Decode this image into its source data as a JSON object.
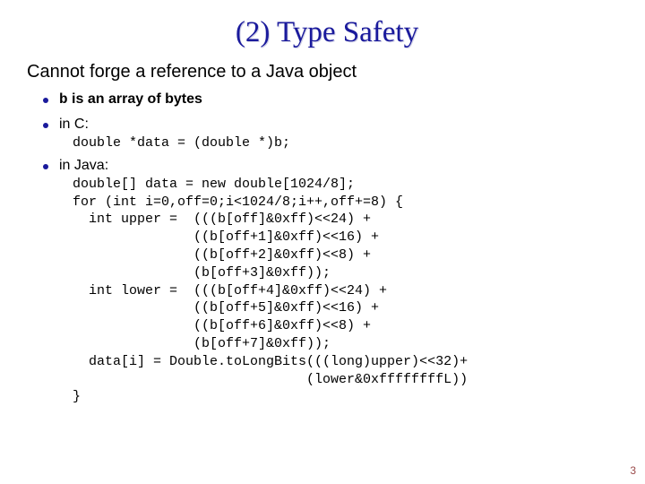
{
  "title": "(2) Type Safety",
  "subtitle": "Cannot forge a reference to a Java object",
  "bullets": {
    "b1_mono": "b",
    "b1_rest": " is an array of bytes",
    "b2": "in C:",
    "b3": "in Java:"
  },
  "code_c": "double *data = (double *)b;",
  "code_java": "double[] data = new double[1024/8];\nfor (int i=0,off=0;i<1024/8;i++,off+=8) {\n  int upper =  (((b[off]&0xff)<<24) +\n               ((b[off+1]&0xff)<<16) +\n               ((b[off+2]&0xff)<<8) +\n               (b[off+3]&0xff));\n  int lower =  (((b[off+4]&0xff)<<24) +\n               ((b[off+5]&0xff)<<16) +\n               ((b[off+6]&0xff)<<8) +\n               (b[off+7]&0xff));\n  data[i] = Double.toLongBits(((long)upper)<<32)+\n                             (lower&0xffffffffL))\n}",
  "pagenum": "3"
}
